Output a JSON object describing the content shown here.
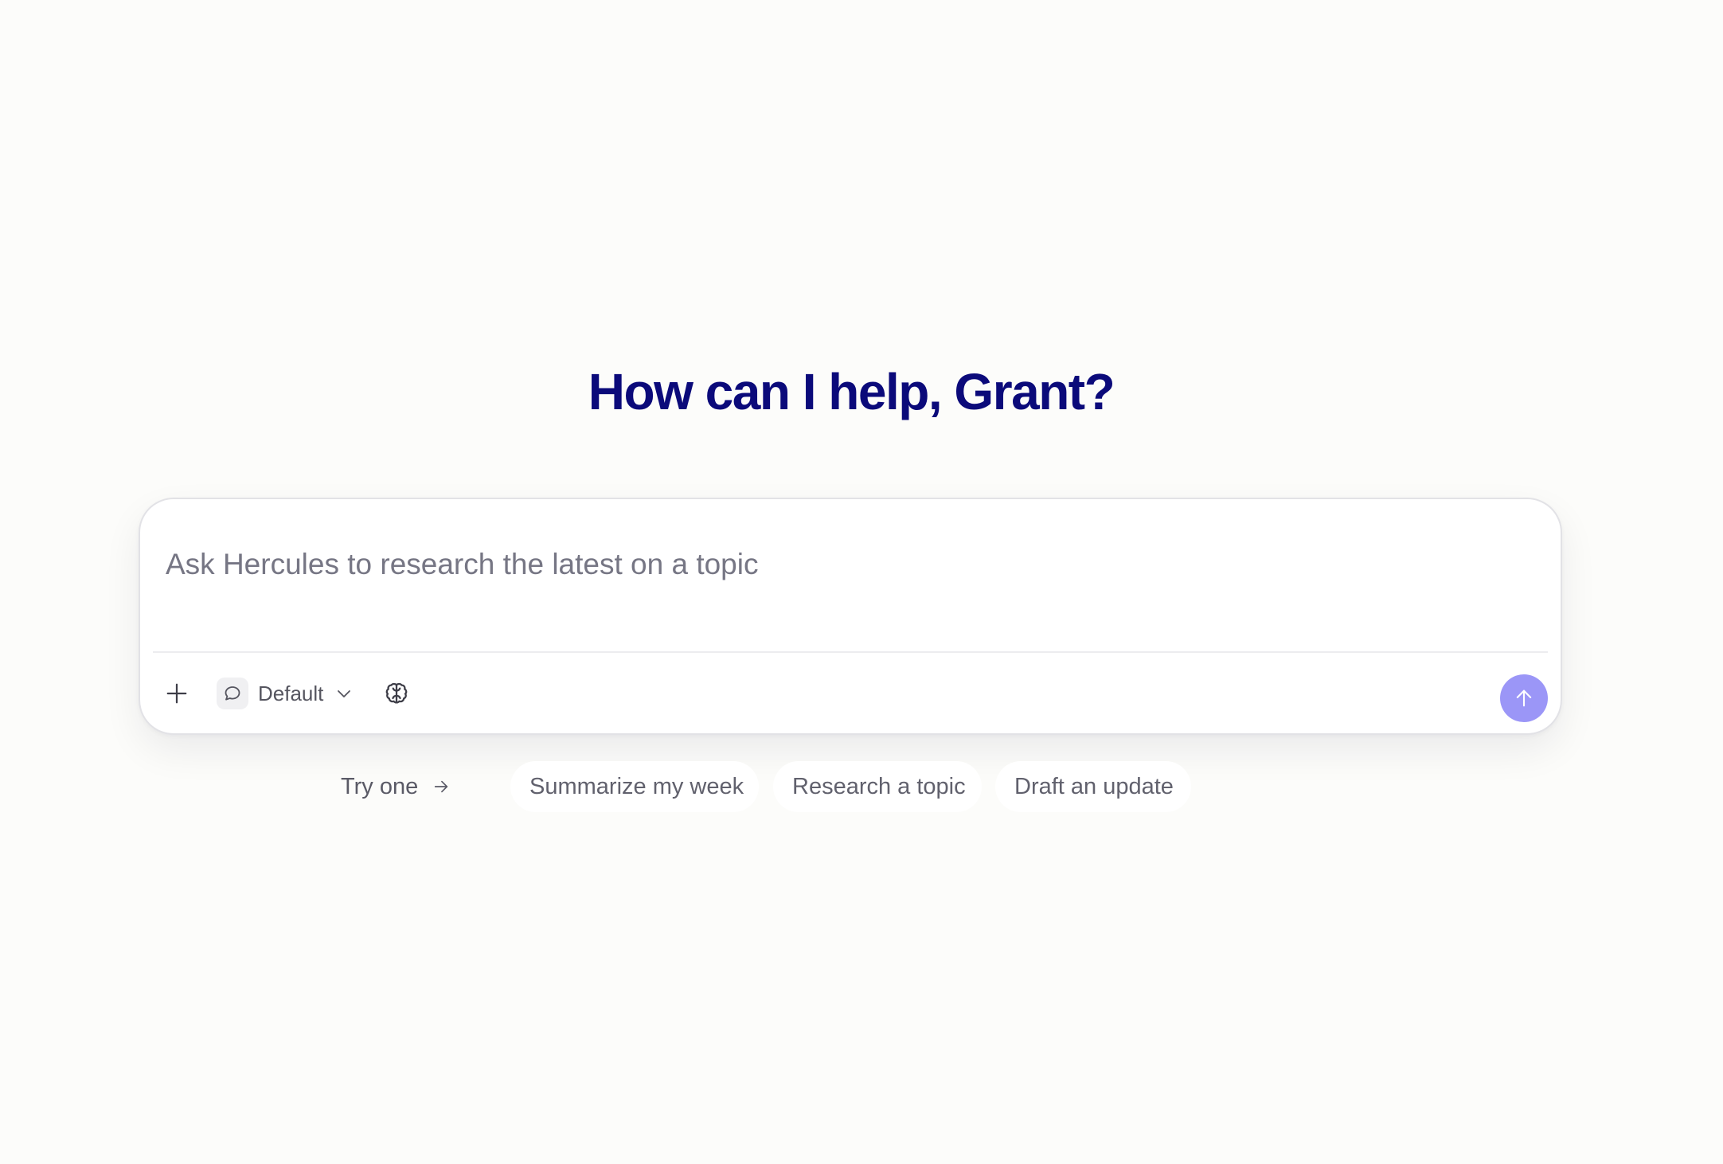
{
  "header": {
    "greeting": "How can I help, Grant?"
  },
  "composer": {
    "placeholder": "Ask Hercules to research the latest on a topic",
    "value": "",
    "add_icon": "plus-icon",
    "mode": {
      "icon": "chat-bubble-icon",
      "label": "Default",
      "dropdown_icon": "chevron-down-icon"
    },
    "brain_icon": "brain-icon",
    "send_icon": "arrow-up-icon"
  },
  "suggestions": {
    "try_label": "Try one",
    "try_icon": "arrow-right-icon",
    "items": [
      {
        "label": "Summarize my week"
      },
      {
        "label": "Research a topic"
      },
      {
        "label": "Draft an update"
      }
    ]
  },
  "colors": {
    "background": "#fcfcfa",
    "heading": "#0b0a7a",
    "send_button": "#9b96f7",
    "placeholder": "#767684",
    "muted_text": "#61616d"
  }
}
